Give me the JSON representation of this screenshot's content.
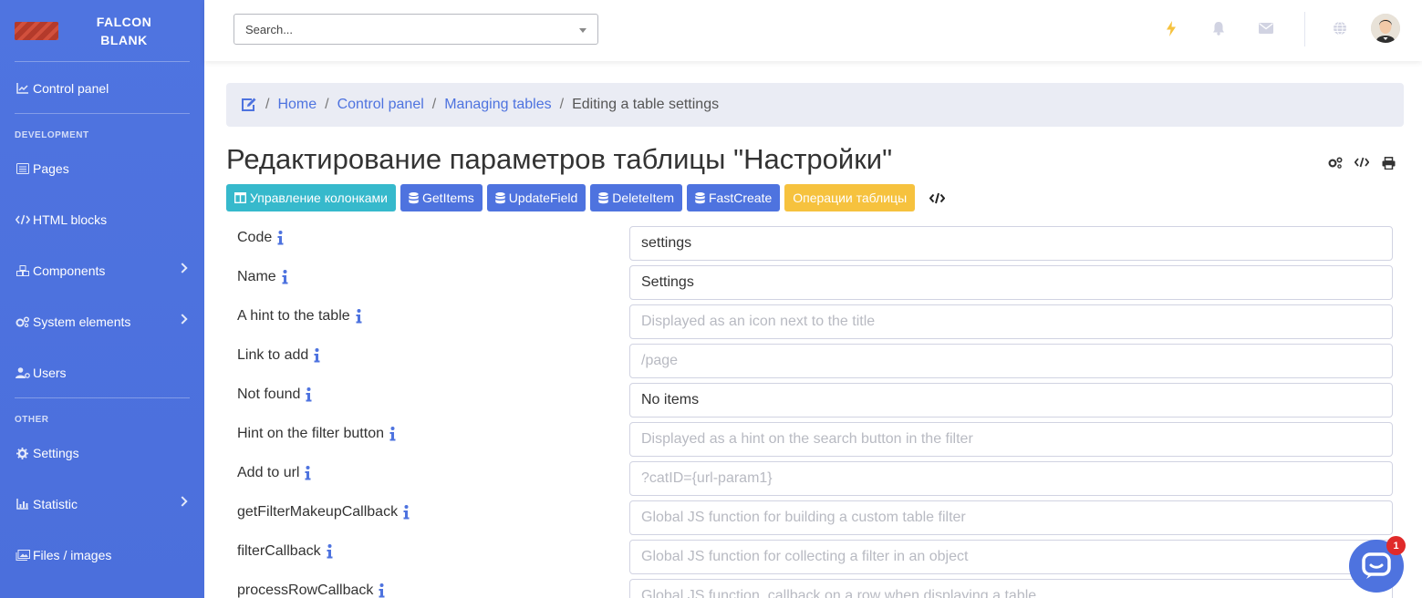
{
  "brand": {
    "line1": "FALCON",
    "line2": "BLANK"
  },
  "sidebar": {
    "control_panel": "Control panel",
    "heading_development": "DEVELOPMENT",
    "pages": "Pages",
    "html_blocks": "HTML blocks",
    "components": "Components",
    "system_elements": "System elements",
    "users": "Users",
    "heading_other": "OTHER",
    "settings": "Settings",
    "statistic": "Statistic",
    "files_images": "Files / images"
  },
  "topbar": {
    "search_placeholder": "Search..."
  },
  "breadcrumb": {
    "home": "Home",
    "control_panel": "Control panel",
    "managing_tables": "Managing tables",
    "current": "Editing a table settings",
    "separator": "/"
  },
  "page": {
    "title": "Редактирование параметров таблицы \"Настройки\""
  },
  "buttons": {
    "columns": "Управление колонками",
    "get_items": "GetItems",
    "update_field": "UpdateField",
    "delete_item": "DeleteItem",
    "fast_create": "FastCreate",
    "table_ops": "Операции таблицы"
  },
  "form": {
    "code": {
      "label": "Code",
      "value": "settings"
    },
    "name": {
      "label": "Name",
      "value": "Settings"
    },
    "hint": {
      "label": "A hint to the table",
      "placeholder": "Displayed as an icon next to the title"
    },
    "link_add": {
      "label": "Link to add",
      "placeholder": "/page"
    },
    "not_found": {
      "label": "Not found",
      "value": "No items"
    },
    "hint_filter": {
      "label": "Hint on the filter button",
      "placeholder": "Displayed as a hint on the search button in the filter"
    },
    "add_url": {
      "label": "Add to url",
      "placeholder": "?catID={url-param1}"
    },
    "filter_makeup": {
      "label": "getFilterMakeupCallback",
      "placeholder": "Global JS function for building a custom table filter"
    },
    "filter_cb": {
      "label": "filterCallback",
      "placeholder": "Global JS function for collecting a filter in an object"
    },
    "process_row": {
      "label": "processRowCallback",
      "placeholder": "Global JS function, callback on a row when displaying a table"
    }
  },
  "chat": {
    "badge": "1"
  },
  "colors": {
    "sidebar": "#4e73df",
    "teal": "#36b9cc",
    "yellow": "#f6c23e",
    "accent": "#4e73df",
    "bolt": "#f6c23e"
  }
}
